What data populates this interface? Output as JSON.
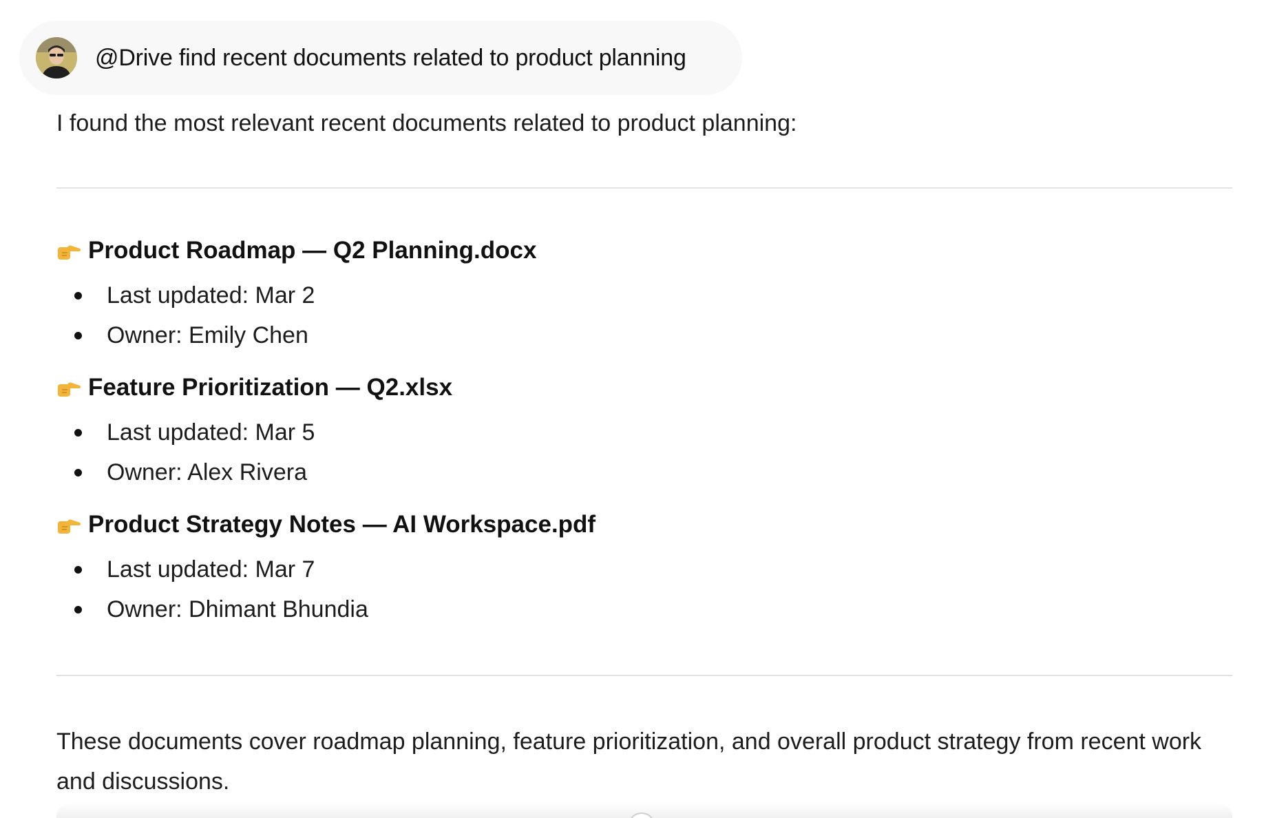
{
  "user_message": {
    "avatar_icon": "user-avatar-photo",
    "text": "@Drive find recent documents related to product planning"
  },
  "response": {
    "intro": "I found the most relevant recent documents related to product planning:",
    "documents": [
      {
        "icon": "pointing-right-hand-icon",
        "title": "Product Roadmap — Q2 Planning.docx",
        "last_updated": "Last updated: Mar 2",
        "owner": "Owner: Emily Chen"
      },
      {
        "icon": "pointing-right-hand-icon",
        "title": "Feature Prioritization — Q2.xlsx",
        "last_updated": "Last updated: Mar 5",
        "owner": "Owner: Alex Rivera"
      },
      {
        "icon": "pointing-right-hand-icon",
        "title": "Product Strategy Notes — AI Workspace.pdf",
        "last_updated": "Last updated: Mar 7",
        "owner": "Owner: Dhimant Bhundia"
      }
    ],
    "summary": "These documents cover roadmap planning, feature prioritization, and overall product strategy from recent work and discussions."
  },
  "colors": {
    "bubble_bg": "#f7f8f7",
    "divider": "#e2e2e2",
    "text": "#1c1c1c",
    "pointer_emoji": "#f2b53a"
  }
}
